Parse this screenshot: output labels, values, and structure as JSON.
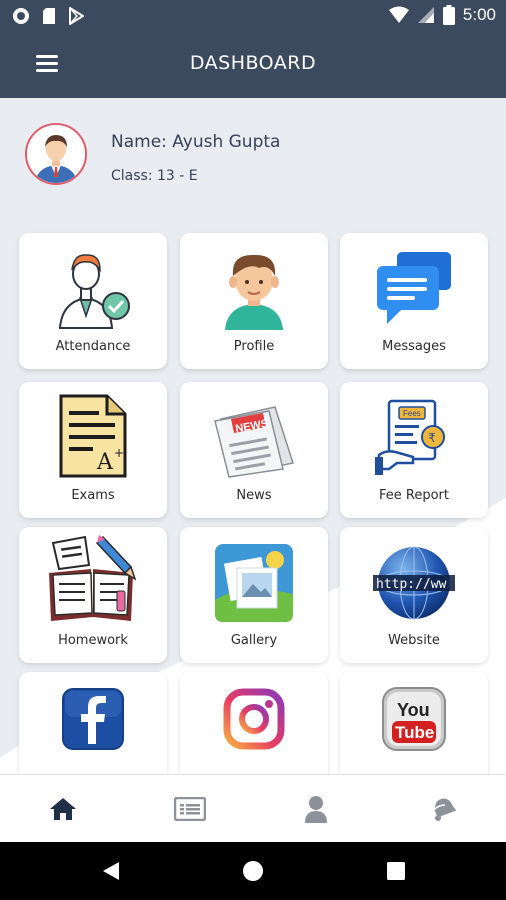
{
  "status_bar": {
    "time": "5:00"
  },
  "app_bar": {
    "title": "DASHBOARD"
  },
  "student": {
    "name": "Name: Ayush Gupta",
    "class": "Class: 13 - E"
  },
  "tiles": [
    {
      "label": "Attendance",
      "icon": "attendance-icon"
    },
    {
      "label": "Profile",
      "icon": "profile-icon"
    },
    {
      "label": "Messages",
      "icon": "messages-icon"
    },
    {
      "label": "Exams",
      "icon": "exams-icon"
    },
    {
      "label": "News",
      "icon": "news-icon"
    },
    {
      "label": "Fee Report",
      "icon": "fee-report-icon"
    },
    {
      "label": "Homework",
      "icon": "homework-icon"
    },
    {
      "label": "Gallery",
      "icon": "gallery-icon"
    },
    {
      "label": "Website",
      "icon": "website-icon"
    },
    {
      "label": "",
      "icon": "facebook-icon"
    },
    {
      "label": "",
      "icon": "instagram-icon"
    },
    {
      "label": "",
      "icon": "youtube-icon"
    }
  ],
  "bottom_nav": [
    {
      "icon": "home-icon"
    },
    {
      "icon": "list-icon"
    },
    {
      "icon": "person-icon"
    },
    {
      "icon": "notification-icon"
    }
  ],
  "colors": {
    "primary": "#3c4a5f",
    "background": "#e9ecf1",
    "tile": "#ffffff"
  }
}
